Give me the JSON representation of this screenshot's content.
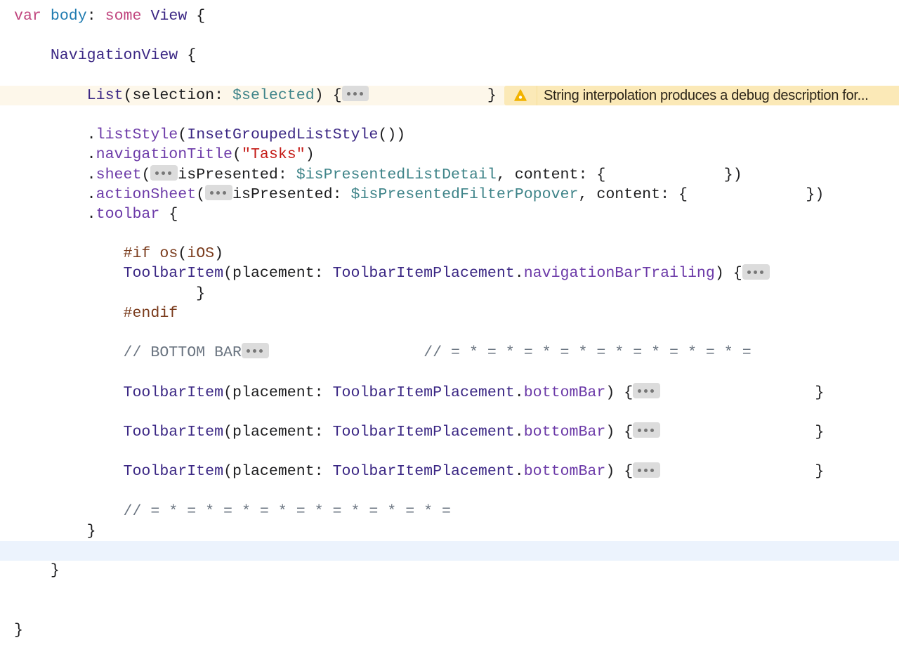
{
  "editor": {
    "colors": {
      "warning_line": "#fdf7ea",
      "warning_banner": "#fbe9b7",
      "current_line": "#ecf3fd"
    },
    "warning": {
      "icon": "warning-triangle-icon",
      "message": "String interpolation produces a debug description for..."
    },
    "lines": [
      [
        {
          "t": "var",
          "c": "kw"
        },
        {
          "t": " "
        },
        {
          "t": "body",
          "c": "decl"
        },
        {
          "t": ": "
        },
        {
          "t": "some",
          "c": "kw"
        },
        {
          "t": " "
        },
        {
          "t": "View",
          "c": "type"
        },
        {
          "t": " {"
        }
      ],
      [],
      [
        {
          "t": "    "
        },
        {
          "t": "NavigationView",
          "c": "type"
        },
        {
          "t": " {"
        }
      ],
      [],
      [
        {
          "t": "        "
        },
        {
          "t": "List",
          "c": "type"
        },
        {
          "t": "(selection: "
        },
        {
          "t": "$selected",
          "c": "var"
        },
        {
          "t": ") {"
        },
        {
          "fold": true
        },
        {
          "t": "             }"
        }
      ],
      [],
      [
        {
          "t": "        ."
        },
        {
          "t": "listStyle",
          "c": "method"
        },
        {
          "t": "("
        },
        {
          "t": "InsetGroupedListStyle",
          "c": "type"
        },
        {
          "t": "())"
        }
      ],
      [
        {
          "t": "        ."
        },
        {
          "t": "navigationTitle",
          "c": "method"
        },
        {
          "t": "("
        },
        {
          "t": "\"Tasks\"",
          "c": "str"
        },
        {
          "t": ")"
        }
      ],
      [
        {
          "t": "        ."
        },
        {
          "t": "sheet",
          "c": "method"
        },
        {
          "t": "("
        },
        {
          "fold": true
        },
        {
          "t": "isPresented: "
        },
        {
          "t": "$isPresentedListDetail",
          "c": "var"
        },
        {
          "t": ", content: {             })"
        }
      ],
      [
        {
          "t": "        ."
        },
        {
          "t": "actionSheet",
          "c": "method"
        },
        {
          "t": "("
        },
        {
          "fold": true
        },
        {
          "t": "isPresented: "
        },
        {
          "t": "$isPresentedFilterPopover",
          "c": "var"
        },
        {
          "t": ", content: {             })"
        }
      ],
      [
        {
          "t": "        ."
        },
        {
          "t": "toolbar",
          "c": "method"
        },
        {
          "t": " {"
        }
      ],
      [],
      [
        {
          "t": "            "
        },
        {
          "t": "#if",
          "c": "pre"
        },
        {
          "t": " "
        },
        {
          "t": "os",
          "c": "pre"
        },
        {
          "t": "("
        },
        {
          "t": "iOS",
          "c": "pre"
        },
        {
          "t": ")"
        }
      ],
      [
        {
          "t": "            "
        },
        {
          "t": "ToolbarItem",
          "c": "type"
        },
        {
          "t": "(placement: "
        },
        {
          "t": "ToolbarItemPlacement",
          "c": "type"
        },
        {
          "t": "."
        },
        {
          "t": "navigationBarTrailing",
          "c": "method"
        },
        {
          "t": ") {"
        },
        {
          "fold": true
        }
      ],
      [
        {
          "t": "                    }"
        }
      ],
      [
        {
          "t": "            "
        },
        {
          "t": "#endif",
          "c": "pre"
        }
      ],
      [],
      [
        {
          "t": "            "
        },
        {
          "t": "// BOTTOM BAR",
          "c": "cmt"
        },
        {
          "fold": true
        },
        {
          "t": "                 "
        },
        {
          "t": "// = * = * = * = * = * = * = * = * =",
          "c": "cmt"
        }
      ],
      [],
      [
        {
          "t": "            "
        },
        {
          "t": "ToolbarItem",
          "c": "type"
        },
        {
          "t": "(placement: "
        },
        {
          "t": "ToolbarItemPlacement",
          "c": "type"
        },
        {
          "t": "."
        },
        {
          "t": "bottomBar",
          "c": "method"
        },
        {
          "t": ") {"
        },
        {
          "fold": true
        },
        {
          "t": "                 }"
        }
      ],
      [],
      [
        {
          "t": "            "
        },
        {
          "t": "ToolbarItem",
          "c": "type"
        },
        {
          "t": "(placement: "
        },
        {
          "t": "ToolbarItemPlacement",
          "c": "type"
        },
        {
          "t": "."
        },
        {
          "t": "bottomBar",
          "c": "method"
        },
        {
          "t": ") {"
        },
        {
          "fold": true
        },
        {
          "t": "                 }"
        }
      ],
      [],
      [
        {
          "t": "            "
        },
        {
          "t": "ToolbarItem",
          "c": "type"
        },
        {
          "t": "(placement: "
        },
        {
          "t": "ToolbarItemPlacement",
          "c": "type"
        },
        {
          "t": "."
        },
        {
          "t": "bottomBar",
          "c": "method"
        },
        {
          "t": ") {"
        },
        {
          "fold": true
        },
        {
          "t": "                 }"
        }
      ],
      [],
      [
        {
          "t": "            "
        },
        {
          "t": "// = * = * = * = * = * = * = * = * =",
          "c": "cmt"
        }
      ],
      [
        {
          "t": "        }"
        }
      ],
      [],
      [
        {
          "t": "    }"
        }
      ],
      [],
      [],
      [
        {
          "t": "}"
        }
      ]
    ],
    "warning_line_index": 4,
    "current_line_index": 27
  }
}
